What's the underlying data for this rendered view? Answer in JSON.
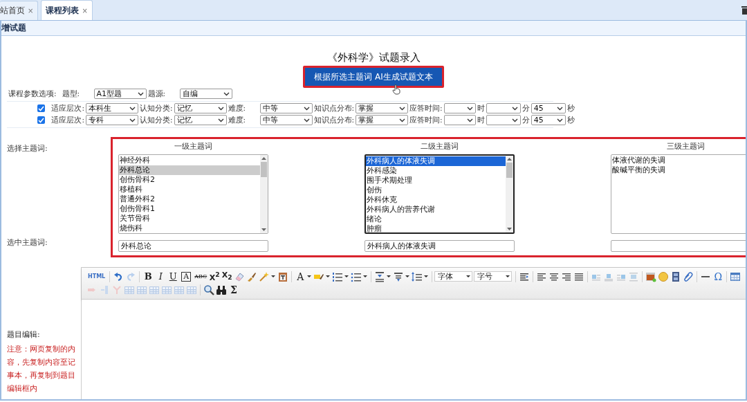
{
  "tabs": [
    {
      "label": "站首页",
      "close": "×",
      "selected": false
    },
    {
      "label": "课程列表",
      "close": "×",
      "selected": true
    }
  ],
  "panel_title": "增试题",
  "page_title": "《外科学》试题录入",
  "generate_button": "根据所选主题词 AI生成试题文本",
  "params": [
    {
      "items": [
        {
          "kind": "label",
          "text": "课程参数选项:"
        },
        {
          "kind": "label",
          "text": "题型:"
        },
        {
          "kind": "select",
          "value": "A1型题"
        },
        {
          "kind": "label",
          "text": "题源:"
        },
        {
          "kind": "select",
          "value": "自编"
        }
      ]
    },
    {
      "items": [
        {
          "kind": "checkbox",
          "checked": true
        },
        {
          "kind": "label",
          "text": "适应层次:"
        },
        {
          "kind": "select",
          "value": "本科生"
        },
        {
          "kind": "label",
          "text": "认知分类:"
        },
        {
          "kind": "select",
          "value": "记忆"
        },
        {
          "kind": "label",
          "text": "难度:"
        },
        {
          "kind": "select",
          "value": "中等"
        },
        {
          "kind": "label",
          "text": "知识点分布:"
        },
        {
          "kind": "select",
          "value": "掌握"
        },
        {
          "kind": "label",
          "text": "应答时间:"
        },
        {
          "kind": "select"
        },
        {
          "kind": "label",
          "text": "时"
        },
        {
          "kind": "select"
        },
        {
          "kind": "label",
          "text": "分"
        },
        {
          "kind": "select",
          "value": "45"
        },
        {
          "kind": "label",
          "text": "秒"
        }
      ]
    },
    {
      "items": [
        {
          "kind": "checkbox",
          "checked": true
        },
        {
          "kind": "label",
          "text": "适应层次:"
        },
        {
          "kind": "select",
          "value": "专科"
        },
        {
          "kind": "label",
          "text": "认知分类:"
        },
        {
          "kind": "select",
          "value": "记忆"
        },
        {
          "kind": "label",
          "text": "难度:"
        },
        {
          "kind": "select",
          "value": "中等"
        },
        {
          "kind": "label",
          "text": "知识点分布:"
        },
        {
          "kind": "select",
          "value": "掌握"
        },
        {
          "kind": "label",
          "text": "应答时间:"
        },
        {
          "kind": "select"
        },
        {
          "kind": "label",
          "text": "时"
        },
        {
          "kind": "select"
        },
        {
          "kind": "label",
          "text": "分"
        },
        {
          "kind": "select",
          "value": "45"
        },
        {
          "kind": "label",
          "text": "秒"
        }
      ]
    }
  ],
  "topics": {
    "label": "选择主题词:",
    "selected_label": "选中主题词:",
    "columns": [
      {
        "title": "一级主题词",
        "focused": false,
        "value": "外科总论",
        "items": [
          {
            "text": "神经外科",
            "selected": false
          },
          {
            "text": "外科总论",
            "selected": true
          },
          {
            "text": "创伤骨科2",
            "selected": false
          },
          {
            "text": "移植科",
            "selected": false
          },
          {
            "text": "普通外科2",
            "selected": false
          },
          {
            "text": "创伤骨科1",
            "selected": false
          },
          {
            "text": "关节骨科",
            "selected": false
          },
          {
            "text": "烧伤科",
            "selected": false
          }
        ]
      },
      {
        "title": "二级主题词",
        "focused": true,
        "value": "外科病人的体液失调",
        "items": [
          {
            "text": "外科病人的体液失调",
            "selected": true
          },
          {
            "text": "外科感染",
            "selected": false
          },
          {
            "text": "围手术期处理",
            "selected": false
          },
          {
            "text": "创伤",
            "selected": false
          },
          {
            "text": "外科休克",
            "selected": false
          },
          {
            "text": "外科病人的营养代谢",
            "selected": false
          },
          {
            "text": "绪论",
            "selected": false
          },
          {
            "text": "肿瘤",
            "selected": false
          }
        ]
      },
      {
        "title": "三级主题词",
        "focused": false,
        "items": [
          {
            "text": "体液代谢的失调",
            "selected": false
          },
          {
            "text": "酸碱平衡的失调",
            "selected": false
          }
        ]
      }
    ]
  },
  "editor": {
    "label": "题目编辑:",
    "note": "注意：网页复制的内容，先复制内容至记事本，再复制到题目编辑框内",
    "glyphs": [
      "HTML",
      "B",
      "I",
      "U",
      "A",
      "ABC",
      "X$^{2}$",
      "X$_{2}$",
      "A",
      "Ω",
      "Σ"
    ],
    "font_select": "字体",
    "size_select": "字号"
  }
}
